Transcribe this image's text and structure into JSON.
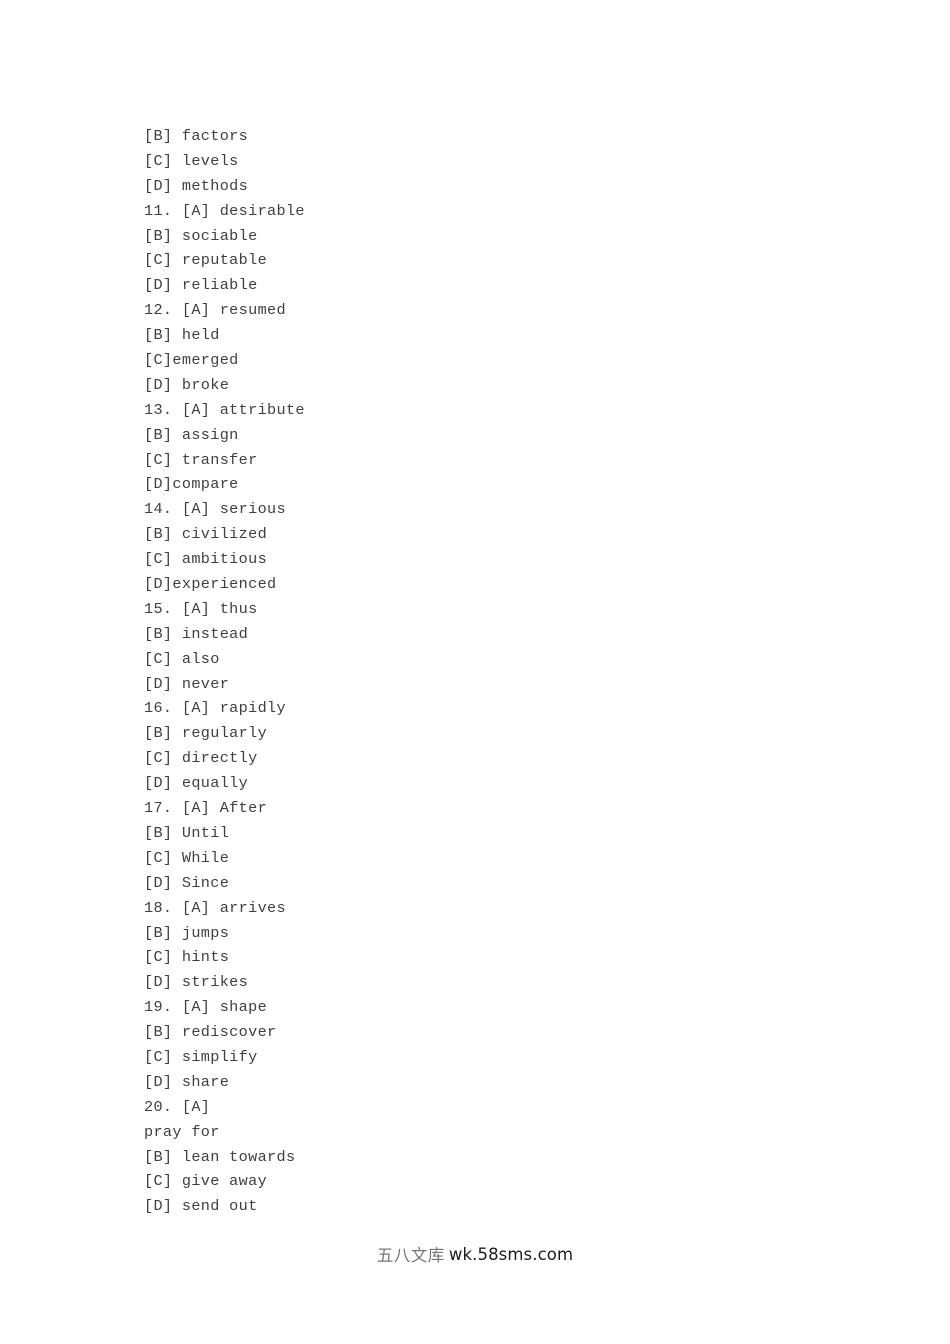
{
  "document": {
    "background_color": "#ffffff",
    "text_color": "#3f3f3f",
    "lines": [
      "[B] factors",
      "[C] levels",
      "[D] methods",
      "11. [A] desirable",
      "[B] sociable",
      "[C] reputable",
      "[D] reliable",
      "12. [A] resumed",
      "[B] held",
      "[C]emerged",
      "[D] broke",
      "13. [A] attribute",
      "[B] assign",
      "[C] transfer",
      "[D]compare",
      "14. [A] serious",
      "[B] civilized",
      "[C] ambitious",
      "[D]experienced",
      "15. [A] thus",
      "[B] instead",
      "[C] also",
      "[D] never",
      "16. [A] rapidly",
      "[B] regularly",
      "[C] directly",
      "[D] equally",
      "17. [A] After",
      "[B] Until",
      "[C] While",
      "[D] Since",
      "18. [A] arrives",
      "[B] jumps",
      "[C] hints",
      "[D] strikes",
      "19. [A] shape",
      "[B] rediscover",
      "[C] simplify",
      "[D] share",
      "20. [A]",
      "pray for",
      "[B] lean towards",
      "[C] give away",
      "[D] send out"
    ]
  },
  "watermark": {
    "site_name": "五八文库",
    "url": "wk.58sms.com",
    "site_name_color": "#767676",
    "url_color": "#1c1c1c"
  }
}
